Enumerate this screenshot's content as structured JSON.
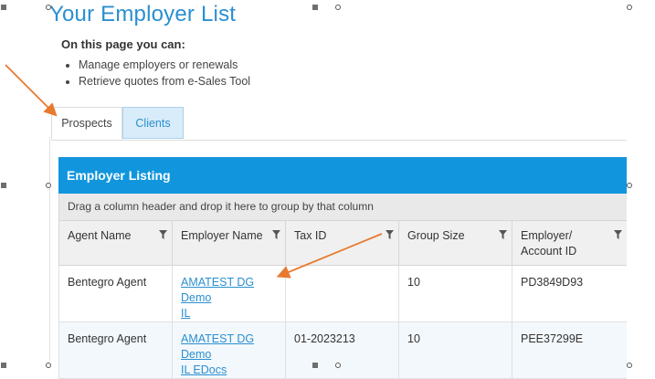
{
  "page": {
    "title": "Your Employer List",
    "intro_heading": "On this page you can:",
    "intro_items": [
      "Manage employers or renewals",
      "Retrieve quotes from e-Sales Tool"
    ]
  },
  "tabs": [
    {
      "label": "Prospects",
      "active": true
    },
    {
      "label": "Clients",
      "active": false
    }
  ],
  "listing": {
    "title": "Employer Listing",
    "group_hint": "Drag a column header and drop it here to group by that column",
    "columns": [
      {
        "label": "Agent Name"
      },
      {
        "label_line1": "Employer Name"
      },
      {
        "label": "Tax ID"
      },
      {
        "label": "Group Size"
      },
      {
        "label_line1": "Employer/",
        "label_line2": "Account ID"
      }
    ],
    "rows": [
      {
        "agent": "Bentegro Agent",
        "employer_line1": "AMATEST DG Demo",
        "employer_line2": "IL",
        "tax_id": "",
        "group_size": "10",
        "account_id": "PD3849D93"
      },
      {
        "agent": "Bentegro Agent",
        "employer_line1": "AMATEST DG Demo",
        "employer_line2": "IL EDocs",
        "tax_id": "01-2023213",
        "group_size": "10",
        "account_id": "PEE37299E"
      }
    ]
  },
  "colors": {
    "title_blue": "#2b8fd0",
    "header_bar": "#1196dd",
    "annotation_arrow": "#e8792e"
  }
}
